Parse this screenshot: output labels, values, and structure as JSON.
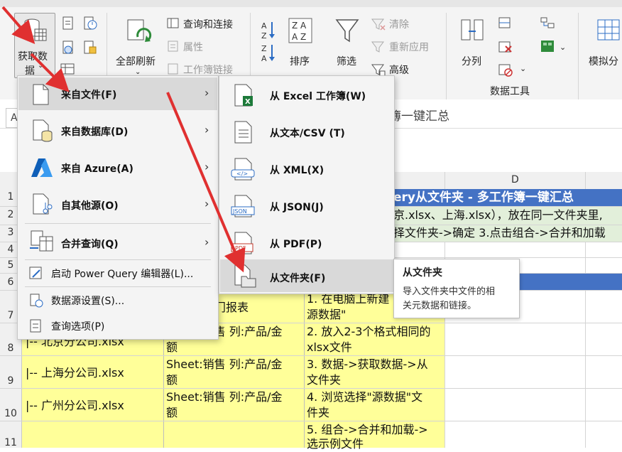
{
  "ribbon": {
    "get_data_label_line1": "获取数",
    "get_data_label_line2": "据",
    "queries_connections": "查询和连接",
    "properties": "属性",
    "workbook_links": "工作簿链接",
    "refresh_all": "全部刷新",
    "sort": "排序",
    "filter": "筛选",
    "clear": "清除",
    "reapply": "重新应用",
    "advanced": "高级",
    "split_columns": "分列",
    "data_tools_group": "数据工具",
    "what_if": "模拟分"
  },
  "sheet": {
    "formula_text": "簿一键汇总",
    "col_d": "D",
    "row_numbers": [
      "1",
      "2",
      "3",
      "4",
      "5",
      "6",
      "7",
      "8",
      "9",
      "10",
      "11"
    ],
    "r1_title": "ery从文件夹 - 多工作簿一键汇总",
    "r2_text": "京.xlsx、上海.xlsx），放在同一文件夹里,",
    "r3_text": "择文件夹->确定  3.点击组合->合并和加载",
    "b7": "门报表",
    "c7_line1": "1. 在电脑上新建",
    "c7_line2": "源数据\"",
    "a8": "|-- 北京分公司.xlsx",
    "b8_line1": "Sheet:销售 列:产品/金",
    "b8_line2": "额",
    "c8_line1": "2. 放入2-3个格式相同的",
    "c8_line2": "xlsx文件",
    "a9": "|-- 上海分公司.xlsx",
    "b9_line1": "Sheet:销售 列:产品/金",
    "b9_line2": "额",
    "c9_line1": "3. 数据->获取数据->从",
    "c9_line2": "文件夹",
    "a10": "|-- 广州分公司.xlsx",
    "b10_line1": "Sheet:销售 列:产品/金",
    "b10_line2": "额",
    "c10_line1": "4. 浏览选择\"源数据\"文",
    "c10_line2": "件夹",
    "c11_line1": "5. 组合->合并和加载->",
    "c11_line2": "选示例文件"
  },
  "menu1": {
    "items": [
      {
        "label": "来自文件(F)",
        "bold": true
      },
      {
        "label": "来自数据库(D)",
        "bold": true
      },
      {
        "label": "来自 Azure(A)",
        "bold": true
      },
      {
        "label": "自其他源(O)",
        "bold": true
      },
      {
        "label": "合并查询(Q)",
        "bold": true
      },
      {
        "label": "启动 Power Query 编辑器(L)..."
      },
      {
        "label": "数据源设置(S)..."
      },
      {
        "label": "查询选项(P)"
      }
    ]
  },
  "menu2": {
    "items": [
      {
        "label": "从 Excel 工作簿(W)"
      },
      {
        "label": "从文本/CSV (T)"
      },
      {
        "label": "从 XML(X)"
      },
      {
        "label": "从 JSON(J)"
      },
      {
        "label": "从 PDF(P)"
      },
      {
        "label": "从文件夹(F)"
      }
    ]
  },
  "tooltip": {
    "title": "从文件夹",
    "body_line1": "导入文件夹中文件的相",
    "body_line2": "关元数据和链接。"
  },
  "colors": {
    "title_row_bg": "#4472c4",
    "header_row_bg": "#4472c4",
    "yellow_cell": "#ffff99",
    "green_band": "#e2efda",
    "arrow": "#e03030",
    "menu_highlight": "#d9d9d9"
  }
}
